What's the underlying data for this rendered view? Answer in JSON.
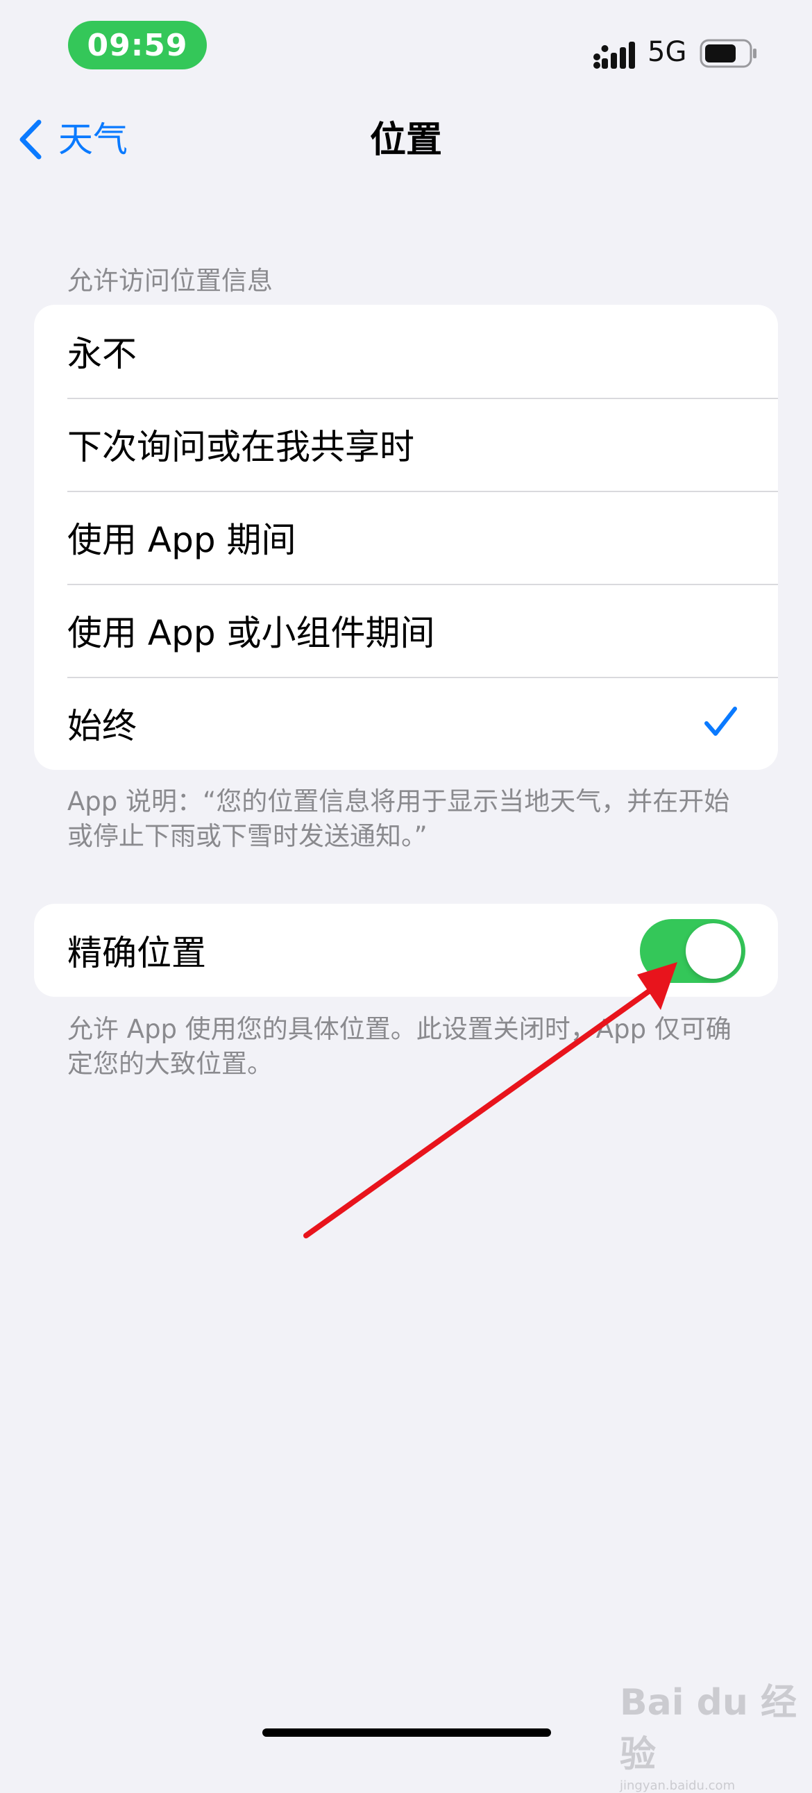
{
  "status_bar": {
    "time": "09:59",
    "network": "5G",
    "time_badge_color": "#34c759"
  },
  "nav": {
    "back_label": "天气",
    "title": "位置",
    "accent_color": "#0a7aff"
  },
  "location_access": {
    "header": "允许访问位置信息",
    "options": [
      {
        "label": "永不",
        "selected": false
      },
      {
        "label": "下次询问或在我共享时",
        "selected": false
      },
      {
        "label": "使用 App 期间",
        "selected": false
      },
      {
        "label": "使用 App 或小组件期间",
        "selected": false
      },
      {
        "label": "始终",
        "selected": true
      }
    ],
    "footnote": "App 说明：“您的位置信息将用于显示当地天气，并在开始或停止下雨或下雪时发送通知。”"
  },
  "precise_location": {
    "label": "精确位置",
    "enabled": true,
    "footnote": "允许 App 使用您的具体位置。此设置关闭时，App 仅可确定您的大致位置。"
  },
  "annotation": {
    "arrow_color": "#e8141c"
  },
  "watermark": {
    "brand": "Bai du 经验",
    "url": "jingyan.baidu.com"
  }
}
